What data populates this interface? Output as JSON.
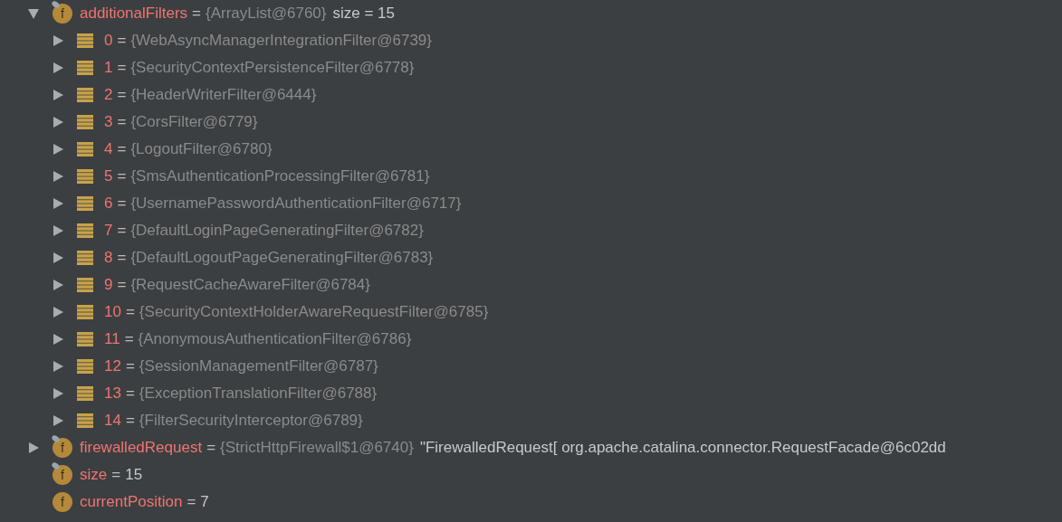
{
  "nodes": [
    {
      "kind": "field",
      "icon_letter": "f",
      "pinned": true,
      "expandable": true,
      "expanded": true,
      "name": "additionalFilters",
      "operator": "=",
      "type_ref": "{ArrayList@6760}",
      "value": "size = 15",
      "children": [
        {
          "kind": "element",
          "expandable": true,
          "expanded": false,
          "name": "0",
          "operator": "=",
          "type_ref": "{WebAsyncManagerIntegrationFilter@6739}"
        },
        {
          "kind": "element",
          "expandable": true,
          "expanded": false,
          "name": "1",
          "operator": "=",
          "type_ref": "{SecurityContextPersistenceFilter@6778}"
        },
        {
          "kind": "element",
          "expandable": true,
          "expanded": false,
          "name": "2",
          "operator": "=",
          "type_ref": "{HeaderWriterFilter@6444}"
        },
        {
          "kind": "element",
          "expandable": true,
          "expanded": false,
          "name": "3",
          "operator": "=",
          "type_ref": "{CorsFilter@6779}"
        },
        {
          "kind": "element",
          "expandable": true,
          "expanded": false,
          "name": "4",
          "operator": "=",
          "type_ref": "{LogoutFilter@6780}"
        },
        {
          "kind": "element",
          "expandable": true,
          "expanded": false,
          "name": "5",
          "operator": "=",
          "type_ref": "{SmsAuthenticationProcessingFilter@6781}"
        },
        {
          "kind": "element",
          "expandable": true,
          "expanded": false,
          "name": "6",
          "operator": "=",
          "type_ref": "{UsernamePasswordAuthenticationFilter@6717}"
        },
        {
          "kind": "element",
          "expandable": true,
          "expanded": false,
          "name": "7",
          "operator": "=",
          "type_ref": "{DefaultLoginPageGeneratingFilter@6782}"
        },
        {
          "kind": "element",
          "expandable": true,
          "expanded": false,
          "name": "8",
          "operator": "=",
          "type_ref": "{DefaultLogoutPageGeneratingFilter@6783}"
        },
        {
          "kind": "element",
          "expandable": true,
          "expanded": false,
          "name": "9",
          "operator": "=",
          "type_ref": "{RequestCacheAwareFilter@6784}"
        },
        {
          "kind": "element",
          "expandable": true,
          "expanded": false,
          "name": "10",
          "operator": "=",
          "type_ref": "{SecurityContextHolderAwareRequestFilter@6785}"
        },
        {
          "kind": "element",
          "expandable": true,
          "expanded": false,
          "name": "11",
          "operator": "=",
          "type_ref": "{AnonymousAuthenticationFilter@6786}"
        },
        {
          "kind": "element",
          "expandable": true,
          "expanded": false,
          "name": "12",
          "operator": "=",
          "type_ref": "{SessionManagementFilter@6787}"
        },
        {
          "kind": "element",
          "expandable": true,
          "expanded": false,
          "name": "13",
          "operator": "=",
          "type_ref": "{ExceptionTranslationFilter@6788}"
        },
        {
          "kind": "element",
          "expandable": true,
          "expanded": false,
          "name": "14",
          "operator": "=",
          "type_ref": "{FilterSecurityInterceptor@6789}"
        }
      ]
    },
    {
      "kind": "field",
      "icon_letter": "f",
      "pinned": true,
      "expandable": true,
      "expanded": false,
      "name": "firewalledRequest",
      "operator": "=",
      "type_ref": "{StrictHttpFirewall$1@6740}",
      "value": "\"FirewalledRequest[ org.apache.catalina.connector.RequestFacade@6c02dd"
    },
    {
      "kind": "field",
      "icon_letter": "f",
      "pinned": true,
      "expandable": false,
      "name": "size",
      "operator": "=",
      "value": "15"
    },
    {
      "kind": "field",
      "icon_letter": "f",
      "pinned": false,
      "expandable": false,
      "name": "currentPosition",
      "operator": "=",
      "value": "7"
    }
  ]
}
